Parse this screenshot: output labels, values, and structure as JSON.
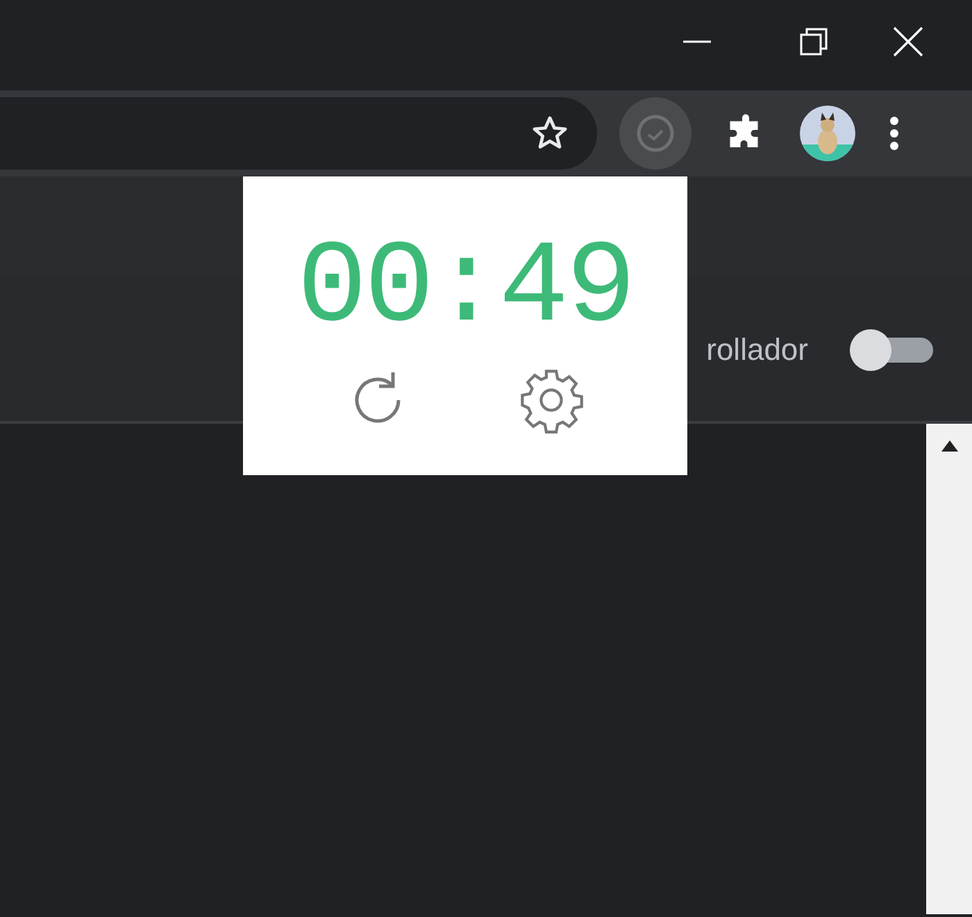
{
  "popup": {
    "timer": "00:49"
  },
  "settings_row": {
    "label": "rollador",
    "on": false
  }
}
